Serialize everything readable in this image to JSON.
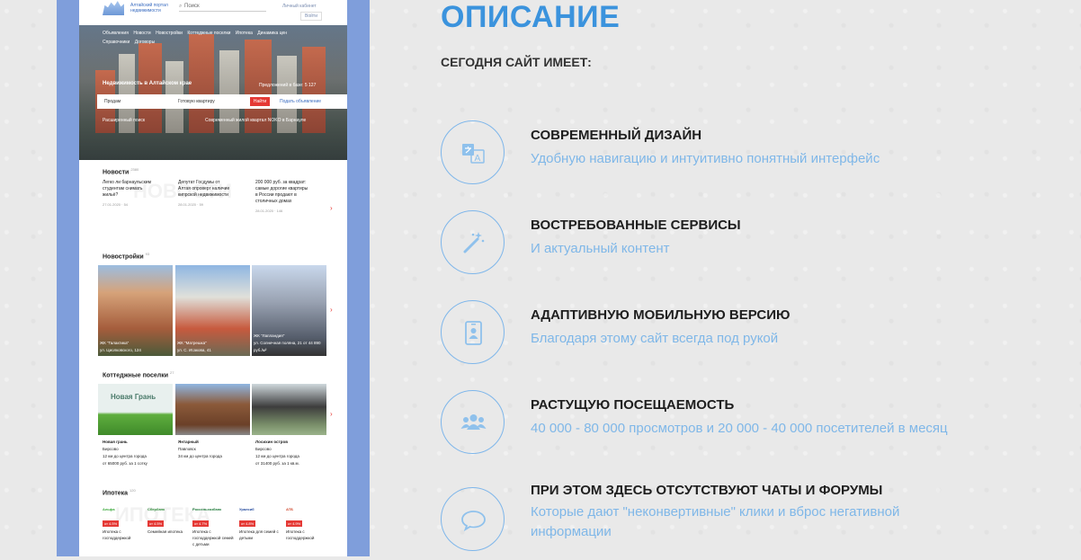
{
  "preview": {
    "brand": "Алтайский портал недвижимости",
    "search_placeholder": "Поиск",
    "cabinet": "Личный кабинет",
    "login": "Войти",
    "nav": [
      "Объявления",
      "Новости",
      "Новостройки",
      "Коттеджные поселки",
      "Ипотека",
      "Динамика цен",
      "Справочники",
      "Договоры"
    ],
    "hero_title": "Недвижимость в Алтайском крае",
    "hero_count": "Предложений в базе: 5 127",
    "form_action": "Продам",
    "form_type": "Готовую квартиру",
    "form_button": "Найти",
    "form_add": "Подать объявление",
    "adv_search": "Расширенный поиск",
    "promo": "Современный жилой квартал NOKO в Барнауле",
    "news": {
      "title": "Новости",
      "count": "2380",
      "watermark": "НОВОСТИ",
      "items": [
        {
          "text": "Легко ли барнаульским студентам снимать жильё?",
          "meta": "27.01.2020 · 54"
        },
        {
          "text": "Депутат Госдумы от Алтая опроверг наличие кипрской недвижимости",
          "meta": "28.01.2020 · 59"
        },
        {
          "text": "200 000 руб. за квадрат: самые дорогие квартиры в России продают в столичных домах",
          "meta": "28.01.2020 · 146"
        }
      ]
    },
    "new_builds": {
      "title": "Новостройки",
      "count": "93",
      "items": [
        {
          "name": "ЖК \"Галактика\"",
          "addr": "ул. Циолковского, 124"
        },
        {
          "name": "ЖК \"Матрешка\"",
          "addr": "ул. С. Исакова, 41"
        },
        {
          "name": "ЖК \"Лапландия\"",
          "addr": "ул. Солнечная поляна, 21 от 44 890 руб./м²"
        }
      ]
    },
    "cottages": {
      "title": "Коттеджные поселки",
      "count": "27",
      "items": [
        {
          "name": "Новая грань",
          "area": "Бирсово",
          "dist": "12 км до центра города",
          "price": "от 65000 руб. за 1 сотку",
          "logo": "Новая Грань"
        },
        {
          "name": "Янтарный",
          "area": "Павловск",
          "dist": "34 км до центра города",
          "price": ""
        },
        {
          "name": "Лосихин остров",
          "area": "Бирсово",
          "dist": "12 км до центра города",
          "price": "от 31400 руб. за 1 кв.м."
        }
      ]
    },
    "mortgage": {
      "title": "Ипотека",
      "count": "120",
      "watermark": "ИПОТЕКА",
      "items": [
        {
          "bank": "Альфа",
          "rate": "от 4.5%",
          "text": "Ипотека с господдержкой"
        },
        {
          "bank": "Сбербанк",
          "rate": "от 4.5%",
          "text": "Семейная ипотека"
        },
        {
          "bank": "Россельхозбанк",
          "rate": "от 4.7%",
          "text": "Ипотека с господдержкой семей с детьми"
        },
        {
          "bank": "Уралсиб",
          "rate": "от 4.8%",
          "text": "Ипотека для семей с детьми"
        },
        {
          "bank": "АТБ",
          "rate": "от 4.9%",
          "text": "Ипотека с господдержкой"
        }
      ]
    }
  },
  "description": {
    "title": "ОПИСАНИЕ",
    "subtitle": "СЕГОДНЯ САЙТ ИМЕЕТ:",
    "features": [
      {
        "icon": "translate-icon",
        "title": "СОВРЕМЕННЫЙ ДИЗАЙН",
        "text": "Удобную навигацию и интуитивно понятный интерфейс"
      },
      {
        "icon": "magic-wand-icon",
        "title": "ВОСТРЕБОВАННЫЕ СЕРВИСЫ",
        "text": "И актуальный контент"
      },
      {
        "icon": "mobile-user-icon",
        "title": "АДАПТИВНУЮ МОБИЛЬНУЮ ВЕРСИЮ",
        "text": "Благодаря этому сайт всегда под рукой"
      },
      {
        "icon": "users-icon",
        "title": "РАСТУЩУЮ ПОСЕЩАЕМОСТЬ",
        "text": "40 000 - 80 000 просмотров и 20 000 - 40 000 посетителей в месяц"
      },
      {
        "icon": "chat-bubble-icon",
        "title": "ПРИ ЭТОМ ЗДЕСЬ ОТСУТСТВУЮТ ЧАТЫ И ФОРУМЫ",
        "text": "Которые дают \"неконвертивные\" клики и вброс негативной информации"
      }
    ]
  },
  "colors": {
    "accent": "#3b93dd",
    "light_accent": "#7fb7e8",
    "frame": "#7f9edb",
    "red": "#e53935"
  }
}
